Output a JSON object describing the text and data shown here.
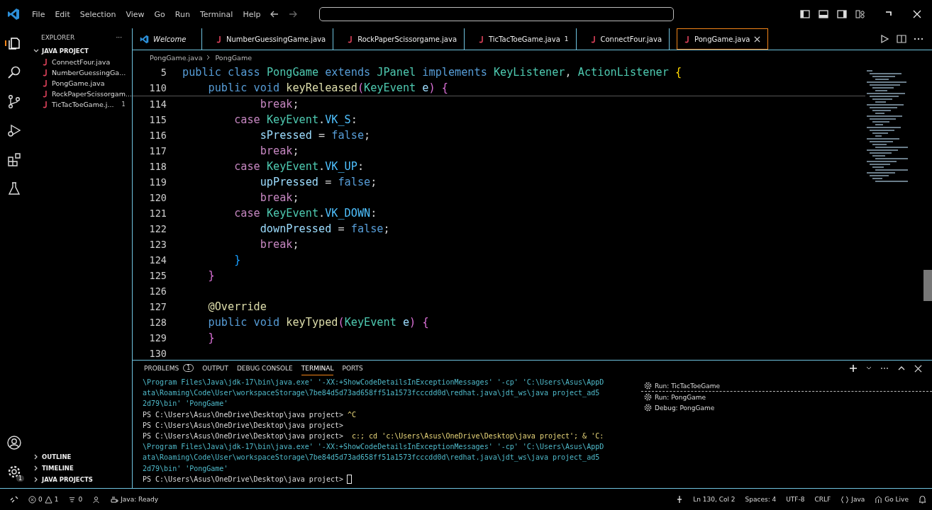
{
  "menu": [
    "File",
    "Edit",
    "Selection",
    "View",
    "Go",
    "Run",
    "Terminal",
    "Help"
  ],
  "sidebar": {
    "title": "EXPLORER",
    "more": "···",
    "folder": {
      "label": "JAVA PROJECT",
      "expanded": true,
      "files": [
        {
          "label": "ConnectFour.java"
        },
        {
          "label": "NumberGuessingGa..."
        },
        {
          "label": "PongGame.java"
        },
        {
          "label": "RockPaperScissorgam..."
        },
        {
          "label": "TicTacToeGame.j...",
          "badge": "1"
        }
      ]
    },
    "sections": [
      {
        "label": "OUTLINE",
        "expanded": false
      },
      {
        "label": "TIMELINE",
        "expanded": false
      },
      {
        "label": "JAVA PROJECTS",
        "expanded": false
      }
    ]
  },
  "tabs": [
    {
      "label": "Welcome",
      "kind": "welcome",
      "selected": false
    },
    {
      "label": "NumberGuessingGame.java",
      "kind": "java",
      "selected": false
    },
    {
      "label": "RockPaperScissorgame.java",
      "kind": "java",
      "selected": false
    },
    {
      "label": "TicTacToeGame.java",
      "kind": "java",
      "selected": false,
      "badge": "1"
    },
    {
      "label": "ConnectFour.java",
      "kind": "java",
      "selected": false
    },
    {
      "label": "PongGame.java",
      "kind": "java",
      "selected": true
    }
  ],
  "breadcrumb": [
    "PongGame.java",
    "PongGame"
  ],
  "sticky": [
    {
      "number": "5",
      "tokens": [
        {
          "t": "public class ",
          "kind": "kw"
        },
        {
          "t": "PongGame ",
          "kind": "type"
        },
        {
          "t": "extends ",
          "kind": "kw"
        },
        {
          "t": "JPanel ",
          "kind": "type"
        },
        {
          "t": "implements ",
          "kind": "kw"
        },
        {
          "t": "KeyListener",
          "kind": "type"
        },
        {
          "t": ", ",
          "kind": "p"
        },
        {
          "t": "ActionListener ",
          "kind": "type"
        },
        {
          "t": "{",
          "kind": "b1"
        }
      ]
    },
    {
      "number": "110",
      "tokens": [
        {
          "t": "    public void ",
          "kind": "kw"
        },
        {
          "t": "keyReleased",
          "kind": "fn"
        },
        {
          "t": "(",
          "kind": "b2"
        },
        {
          "t": "KeyEvent ",
          "kind": "type"
        },
        {
          "t": "e",
          "kind": "var"
        },
        {
          "t": ") ",
          "kind": "b2"
        },
        {
          "t": "{",
          "kind": "b2"
        }
      ]
    }
  ],
  "lines": [
    {
      "number": "114",
      "tokens": [
        {
          "t": "            break",
          "kind": "ctl"
        },
        {
          "t": ";",
          "kind": "p"
        }
      ]
    },
    {
      "number": "115",
      "tokens": [
        {
          "t": "        case ",
          "kind": "ctl"
        },
        {
          "t": "KeyEvent",
          "kind": "type"
        },
        {
          "t": ".",
          "kind": "p"
        },
        {
          "t": "VK_S",
          "kind": "const"
        },
        {
          "t": ":",
          "kind": "p"
        }
      ]
    },
    {
      "number": "116",
      "tokens": [
        {
          "t": "            sPressed ",
          "kind": "var"
        },
        {
          "t": "= ",
          "kind": "p"
        },
        {
          "t": "false",
          "kind": "kw"
        },
        {
          "t": ";",
          "kind": "p"
        }
      ]
    },
    {
      "number": "117",
      "tokens": [
        {
          "t": "            break",
          "kind": "ctl"
        },
        {
          "t": ";",
          "kind": "p"
        }
      ]
    },
    {
      "number": "118",
      "tokens": [
        {
          "t": "        case ",
          "kind": "ctl"
        },
        {
          "t": "KeyEvent",
          "kind": "type"
        },
        {
          "t": ".",
          "kind": "p"
        },
        {
          "t": "VK_UP",
          "kind": "const"
        },
        {
          "t": ":",
          "kind": "p"
        }
      ]
    },
    {
      "number": "119",
      "tokens": [
        {
          "t": "            upPressed ",
          "kind": "var"
        },
        {
          "t": "= ",
          "kind": "p"
        },
        {
          "t": "false",
          "kind": "kw"
        },
        {
          "t": ";",
          "kind": "p"
        }
      ]
    },
    {
      "number": "120",
      "tokens": [
        {
          "t": "            break",
          "kind": "ctl"
        },
        {
          "t": ";",
          "kind": "p"
        }
      ]
    },
    {
      "number": "121",
      "tokens": [
        {
          "t": "        case ",
          "kind": "ctl"
        },
        {
          "t": "KeyEvent",
          "kind": "type"
        },
        {
          "t": ".",
          "kind": "p"
        },
        {
          "t": "VK_DOWN",
          "kind": "const"
        },
        {
          "t": ":",
          "kind": "p"
        }
      ]
    },
    {
      "number": "122",
      "tokens": [
        {
          "t": "            downPressed ",
          "kind": "var"
        },
        {
          "t": "= ",
          "kind": "p"
        },
        {
          "t": "false",
          "kind": "kw"
        },
        {
          "t": ";",
          "kind": "p"
        }
      ]
    },
    {
      "number": "123",
      "tokens": [
        {
          "t": "            break",
          "kind": "ctl"
        },
        {
          "t": ";",
          "kind": "p"
        }
      ]
    },
    {
      "number": "124",
      "tokens": [
        {
          "t": "        }",
          "kind": "b3"
        }
      ]
    },
    {
      "number": "125",
      "tokens": [
        {
          "t": "    }",
          "kind": "b2"
        }
      ]
    },
    {
      "number": "126"
    },
    {
      "number": "127",
      "tokens": [
        {
          "t": "    @Override",
          "kind": "ann"
        }
      ]
    },
    {
      "number": "128",
      "tokens": [
        {
          "t": "    public void ",
          "kind": "kw"
        },
        {
          "t": "keyTyped",
          "kind": "fn"
        },
        {
          "t": "(",
          "kind": "b2"
        },
        {
          "t": "KeyEvent ",
          "kind": "type"
        },
        {
          "t": "e",
          "kind": "var"
        },
        {
          "t": ") ",
          "kind": "b2"
        },
        {
          "t": "{",
          "kind": "b2"
        }
      ]
    },
    {
      "number": "129",
      "tokens": [
        {
          "t": "    }",
          "kind": "b2"
        }
      ]
    },
    {
      "number": "130"
    }
  ],
  "panel": {
    "tabs": [
      {
        "label": "PROBLEMS",
        "badge": "1",
        "selected": false
      },
      {
        "label": "OUTPUT",
        "selected": false
      },
      {
        "label": "DEBUG CONSOLE",
        "selected": false
      },
      {
        "label": "TERMINAL",
        "selected": true
      },
      {
        "label": "PORTS",
        "selected": false
      }
    ],
    "terminal": [
      {
        "kind": "output",
        "text": "\\Program Files\\Java\\jdk-17\\bin\\java.exe' '-XX:+ShowCodeDetailsInExceptionMessages' '-cp' 'C:\\Users\\Asus\\AppD"
      },
      {
        "kind": "output",
        "text": "ata\\Roaming\\Code\\User\\workspaceStorage\\7be84d5d73ad658ff51a1573fcccdd0d\\redhat.java\\jdt_ws\\java project_ad5"
      },
      {
        "kind": "output",
        "text": "2d79\\bin' 'PongGame'"
      },
      {
        "kind": "prompt",
        "prompt": "PS C:\\Users\\Asus\\OneDrive\\Desktop\\java project>",
        "command": " ^C"
      },
      {
        "kind": "prompt",
        "prompt": "PS C:\\Users\\Asus\\OneDrive\\Desktop\\java project>"
      },
      {
        "kind": "prompt",
        "prompt": "PS C:\\Users\\Asus\\OneDrive\\Desktop\\java project>",
        "command": "  c:; cd 'c:\\Users\\Asus\\OneDrive\\Desktop\\java project'; & 'C:"
      },
      {
        "kind": "output",
        "text": "\\Program Files\\Java\\jdk-17\\bin\\java.exe' '-XX:+ShowCodeDetailsInExceptionMessages' '-cp' 'C:\\Users\\Asus\\AppD"
      },
      {
        "kind": "output",
        "text": "ata\\Roaming\\Code\\User\\workspaceStorage\\7be84d5d73ad658ff51a1573fcccdd0d\\redhat.java\\jdt_ws\\java project_ad5"
      },
      {
        "kind": "output",
        "text": "2d79\\bin' 'PongGame'"
      },
      {
        "kind": "prompt",
        "prompt": "PS C:\\Users\\Asus\\OneDrive\\Desktop\\java project>",
        "cursor": true
      }
    ],
    "sessions": [
      {
        "label": "Run: TicTacToeGame",
        "selected": false
      },
      {
        "label": "Run: PongGame",
        "selected": false
      },
      {
        "label": "Debug: PongGame",
        "selected": false
      }
    ]
  },
  "status": {
    "errors": "0",
    "warnings": "1",
    "ports": "0",
    "java": "Java: Ready",
    "position": "Ln 130, Col 2",
    "spaces": "Spaces: 4",
    "encoding": "UTF-8",
    "eol": "CRLF",
    "language": "Java",
    "live": "Go Live"
  },
  "settings_badge": "1"
}
